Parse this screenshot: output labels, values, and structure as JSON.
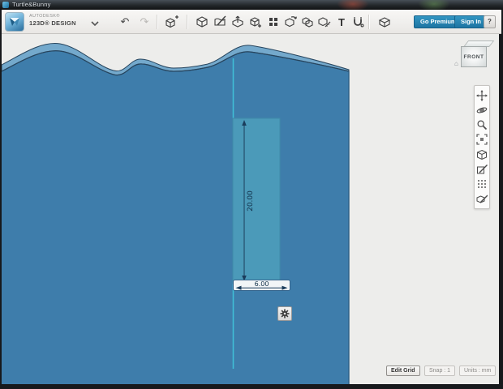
{
  "window": {
    "title": "Turtle&Bunny"
  },
  "toolbar": {
    "brand_line1": "AUTODESK®",
    "brand_line2": "123D® DESIGN",
    "go_premium_label": "Go Premium",
    "sign_in_label": "Sign In",
    "help_label": "?"
  },
  "icons": {
    "undo_glyph": "↶",
    "redo_glyph": "↷",
    "text_tool_glyph": "T",
    "home_glyph": "⌂"
  },
  "viewcube": {
    "front_label": "FRONT"
  },
  "sketch": {
    "height_dimension": "20.00",
    "width_dimension": "6.00"
  },
  "statusbar": {
    "edit_grid_label": "Edit Grid",
    "snap_label": "Snap : 1",
    "units_label": "Units : mm"
  },
  "colors": {
    "body_blue": "#3e7dab",
    "band_blue": "#74a9cc",
    "outline_navy": "#27455e",
    "selection_teal": "#4b9ab9",
    "construction_cyan": "#41bdd6",
    "dimension_navy": "#1b3d5c",
    "accent_button_blue": "#1d74a2"
  }
}
